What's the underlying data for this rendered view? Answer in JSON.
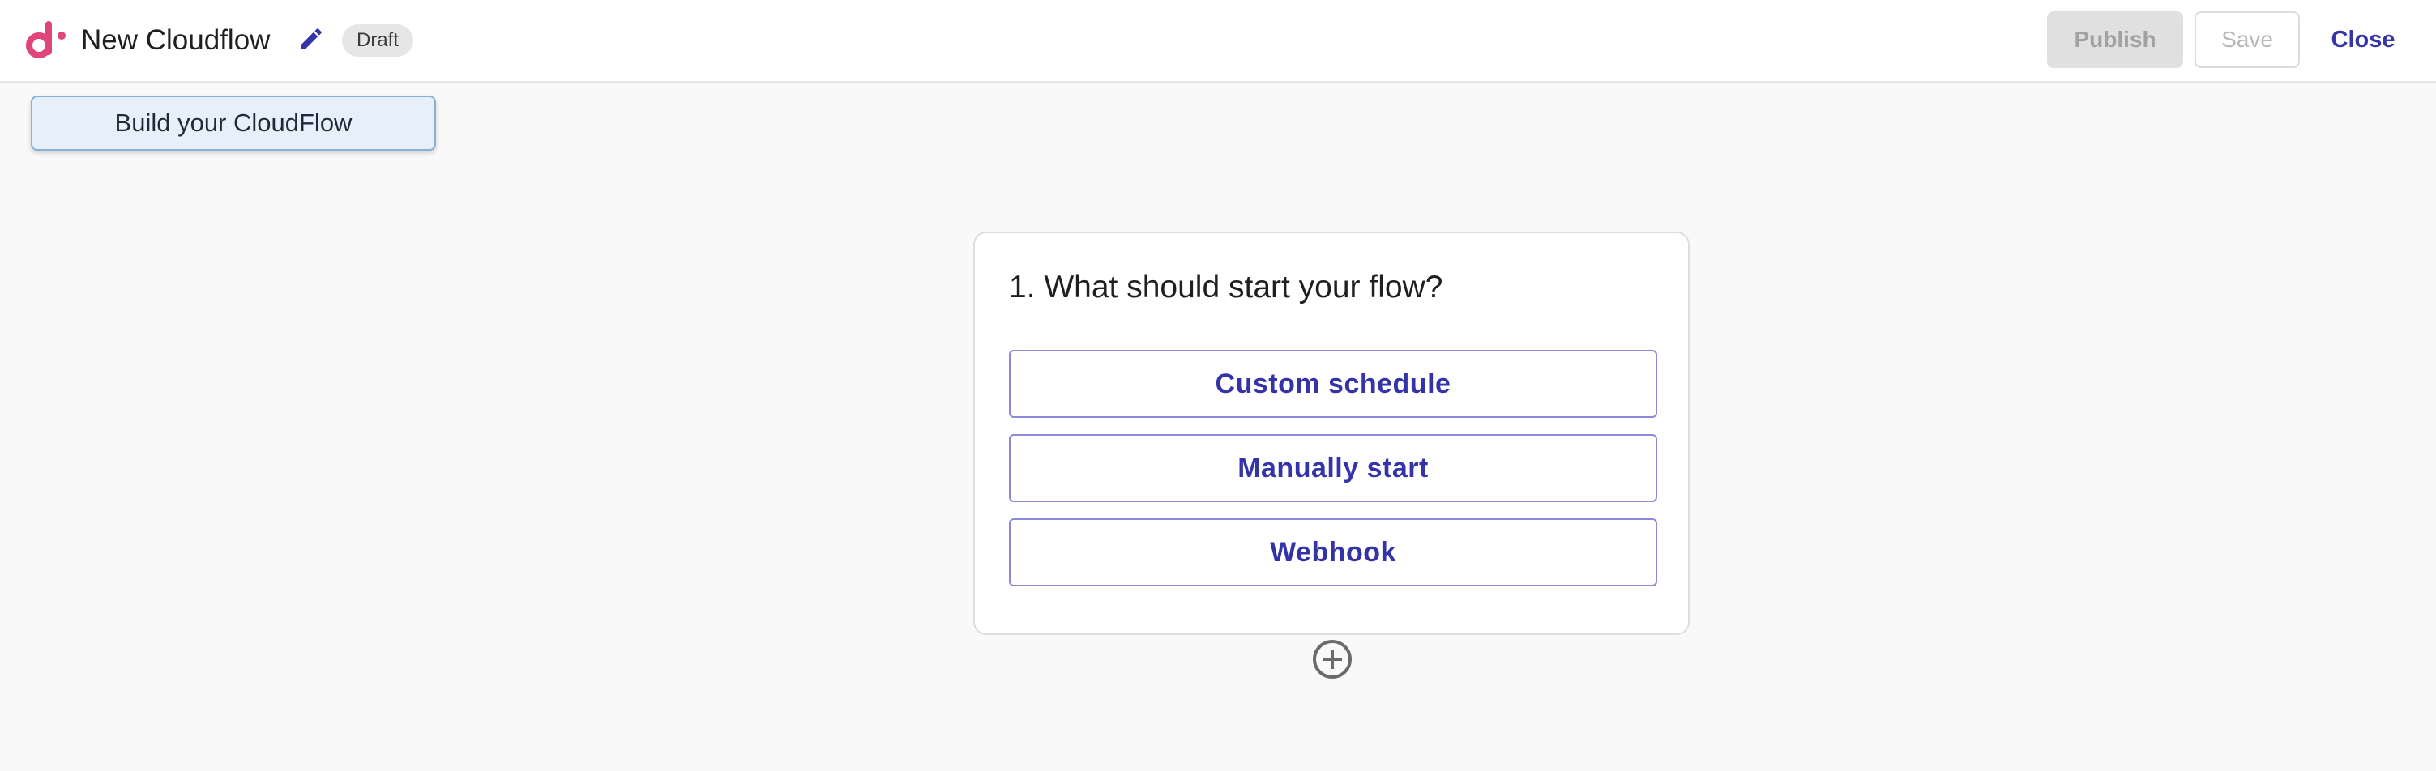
{
  "header": {
    "title": "New Cloudflow",
    "status_badge": "Draft",
    "publish_label": "Publish",
    "save_label": "Save",
    "close_label": "Close"
  },
  "builder_tab": {
    "label": "Build your CloudFlow"
  },
  "trigger_card": {
    "title": "1. What should start your flow?",
    "options": [
      {
        "label": "Custom schedule"
      },
      {
        "label": "Manually start"
      },
      {
        "label": "Webhook"
      }
    ]
  },
  "icons": {
    "logo": "logo-icon",
    "edit": "pencil-icon",
    "add_step": "plus-circle-icon"
  },
  "colors": {
    "brand_pink": "#e0457b",
    "accent": "#3433a8",
    "option_border": "#8c89d8",
    "disabled_bg": "#e0e0e0",
    "disabled_text": "#a2a2a2"
  }
}
